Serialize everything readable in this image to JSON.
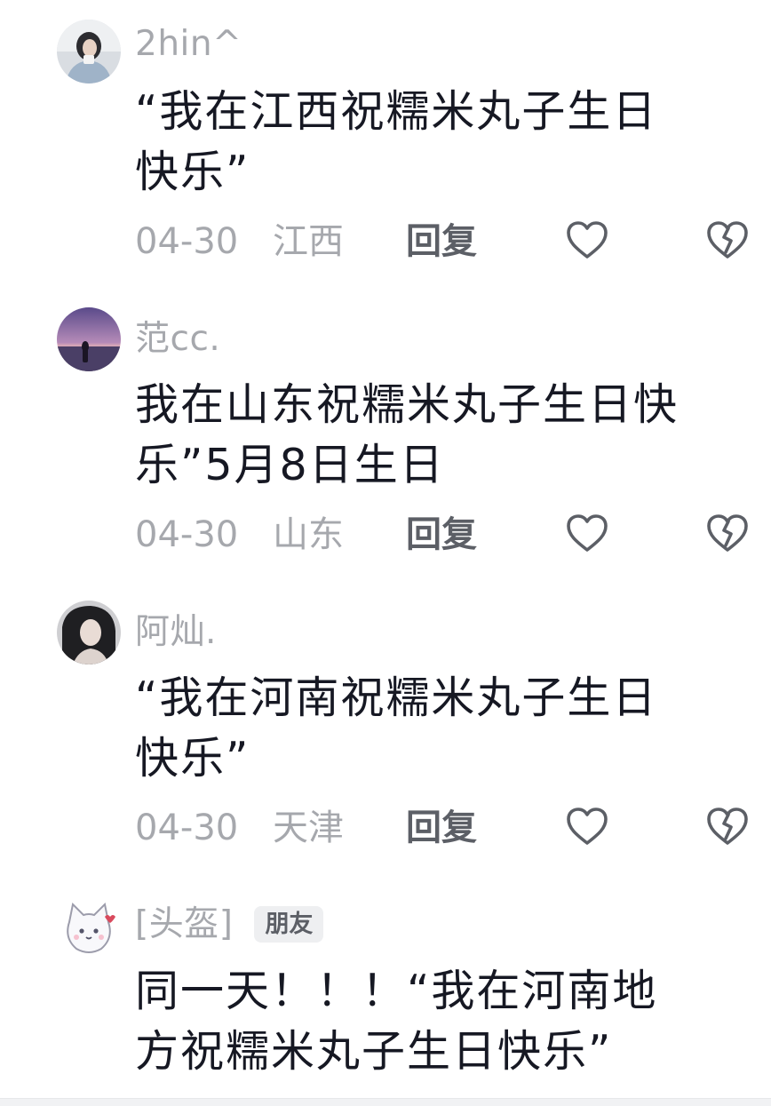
{
  "comments": [
    {
      "username": "2hin^",
      "text": "“我在江西祝糯米丸子生日\n快乐”",
      "date": "04-30",
      "location": "江西",
      "reply_label": "回复",
      "avatar_icon": "avatar-girl-photo"
    },
    {
      "username": "范cc.",
      "text": "我在山东祝糯米丸子生日快\n乐”5月8日生日",
      "date": "04-30",
      "location": "山东",
      "reply_label": "回复",
      "avatar_icon": "avatar-sunset-silhouette"
    },
    {
      "username": "阿灿.",
      "text": "“我在河南祝糯米丸子生日\n快乐”",
      "date": "04-30",
      "location": "天津",
      "reply_label": "回复",
      "avatar_icon": "avatar-portrait"
    },
    {
      "username": "[头盔]",
      "badge": "朋友",
      "text": "同一天！！！“我在河南地\n方祝糯米丸子生日快乐”",
      "avatar_icon": "avatar-cartoon-cat"
    }
  ],
  "icons": {
    "like": "heart-outline-icon",
    "dislike": "broken-heart-icon"
  },
  "colors": {
    "text_primary": "#161823",
    "text_secondary": "#a6a8ad",
    "reply": "#5c5f66",
    "badge_bg": "#eeeff1"
  }
}
